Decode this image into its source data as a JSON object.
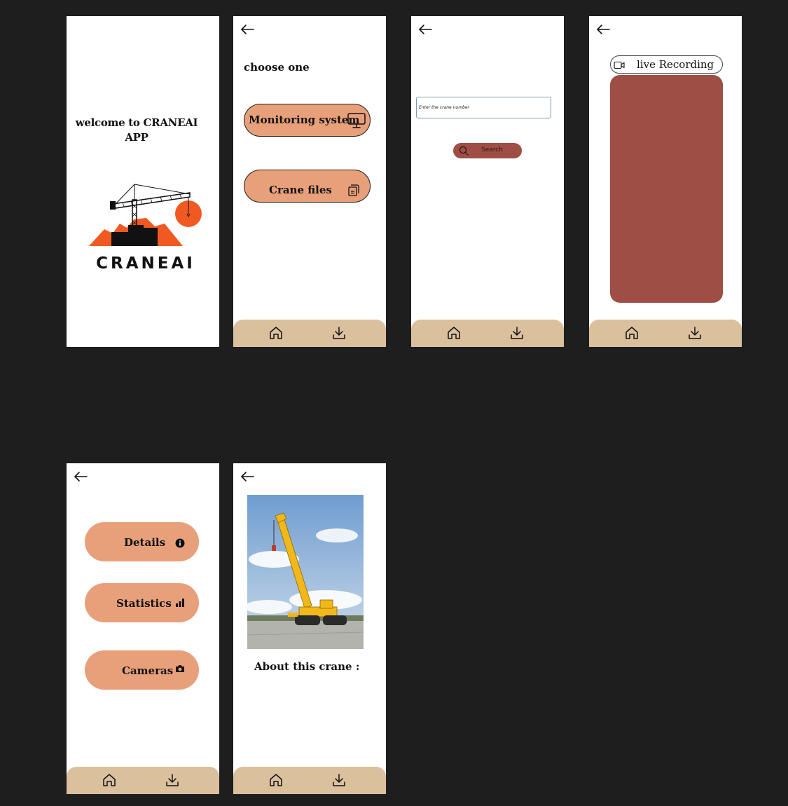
{
  "colors": {
    "canvas_bg": "#1e1e1e",
    "screen_bg": "#ffffff",
    "nav_bar": "#dbc09e",
    "pill_orange": "#e8a07b",
    "brick_red": "#9e4e44",
    "logo_orange": "#f05a22"
  },
  "welcome": {
    "title_line1": "welcome to CRANEAI",
    "title_line2": "APP",
    "brand": "CRANEAI",
    "logo_icon": "crane-logo"
  },
  "choose": {
    "heading": "choose one",
    "options": [
      {
        "label": "Monitoring system",
        "icon": "monitor-icon"
      },
      {
        "label": "Crane files",
        "icon": "files-icon"
      }
    ]
  },
  "search": {
    "placeholder": "Enter the crane number",
    "button_label": "Search",
    "button_icon": "search-icon"
  },
  "live": {
    "label": "live Recording",
    "icon": "video-camera-icon"
  },
  "crane_menu": {
    "items": [
      {
        "label": "Details",
        "icon": "info-icon"
      },
      {
        "label": "Statistics",
        "icon": "bar-chart-icon"
      },
      {
        "label": "Cameras",
        "icon": "camera-icon"
      }
    ]
  },
  "crane_detail": {
    "about_label": "About this crane :",
    "photo": "mobile-crane-photo"
  },
  "nav": {
    "icons": [
      "back-arrow-icon",
      "home-icon",
      "download-icon"
    ]
  }
}
